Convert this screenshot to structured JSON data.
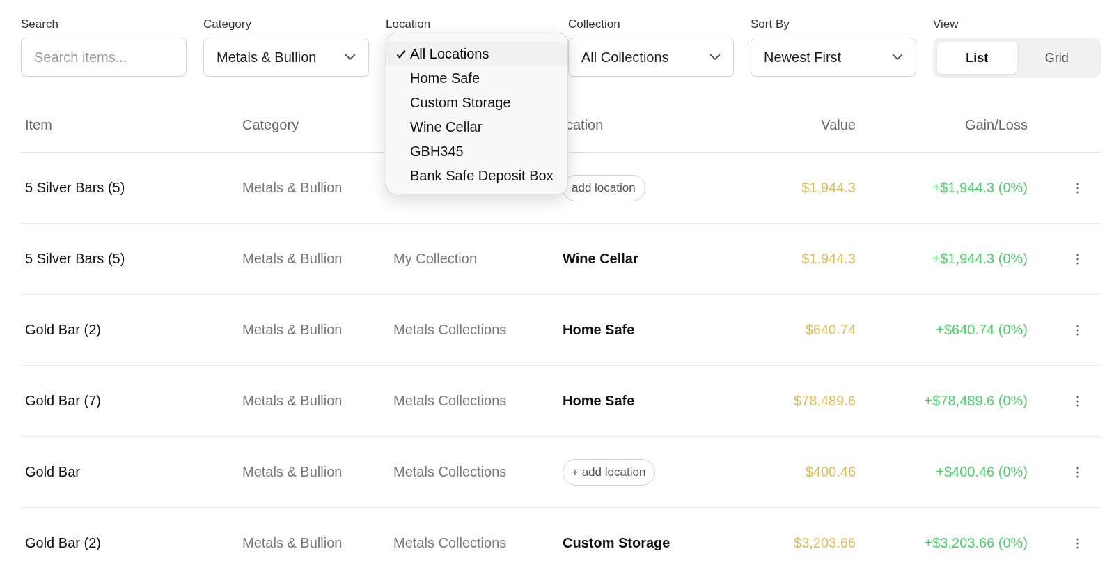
{
  "filters": {
    "search": {
      "label": "Search",
      "placeholder": "Search items..."
    },
    "category": {
      "label": "Category",
      "value": "Metals & Bullion"
    },
    "location": {
      "label": "Location",
      "open": true,
      "options": [
        {
          "label": "All Locations",
          "selected": true
        },
        {
          "label": "Home Safe",
          "selected": false
        },
        {
          "label": "Custom Storage",
          "selected": false
        },
        {
          "label": "Wine Cellar",
          "selected": false
        },
        {
          "label": "GBH345",
          "selected": false
        },
        {
          "label": "Bank Safe Deposit Box",
          "selected": false
        }
      ]
    },
    "collection": {
      "label": "Collection",
      "value": "All Collections"
    },
    "sort": {
      "label": "Sort By",
      "value": "Newest First"
    },
    "view": {
      "label": "View",
      "options": [
        {
          "label": "List",
          "selected": true
        },
        {
          "label": "Grid",
          "selected": false
        }
      ]
    }
  },
  "table": {
    "columns": {
      "item": "Item",
      "category": "Category",
      "location": "cation",
      "value": "Value",
      "gain": "Gain/Loss"
    },
    "rows": [
      {
        "item": "5 Silver Bars (5)",
        "category": "Metals & Bullion",
        "location": {
          "kind": "add",
          "text": "add location"
        },
        "value": "$1,944.3",
        "gain": "+$1,944.3 (0%)"
      },
      {
        "item": "5 Silver Bars (5)",
        "category": "Metals & Bullion",
        "collection": "My Collection",
        "location": {
          "kind": "place",
          "text": "Wine Cellar"
        },
        "value": "$1,944.3",
        "gain": "+$1,944.3 (0%)"
      },
      {
        "item": "Gold Bar (2)",
        "category": "Metals & Bullion",
        "collection": "Metals Collections",
        "location": {
          "kind": "place",
          "text": "Home Safe"
        },
        "value": "$640.74",
        "gain": "+$640.74 (0%)"
      },
      {
        "item": "Gold Bar (7)",
        "category": "Metals & Bullion",
        "collection": "Metals Collections",
        "location": {
          "kind": "place",
          "text": "Home Safe"
        },
        "value": "$78,489.6",
        "gain": "+$78,489.6 (0%)"
      },
      {
        "item": "Gold Bar",
        "category": "Metals & Bullion",
        "collection": "Metals Collections",
        "location": {
          "kind": "add",
          "text": "+ add location"
        },
        "value": "$400.46",
        "gain": "+$400.46 (0%)"
      },
      {
        "item": "Gold Bar (2)",
        "category": "Metals & Bullion",
        "collection": "Metals Collections",
        "location": {
          "kind": "place",
          "text": "Custom Storage"
        },
        "value": "$3,203.66",
        "gain": "+$3,203.66 (0%)"
      }
    ]
  }
}
